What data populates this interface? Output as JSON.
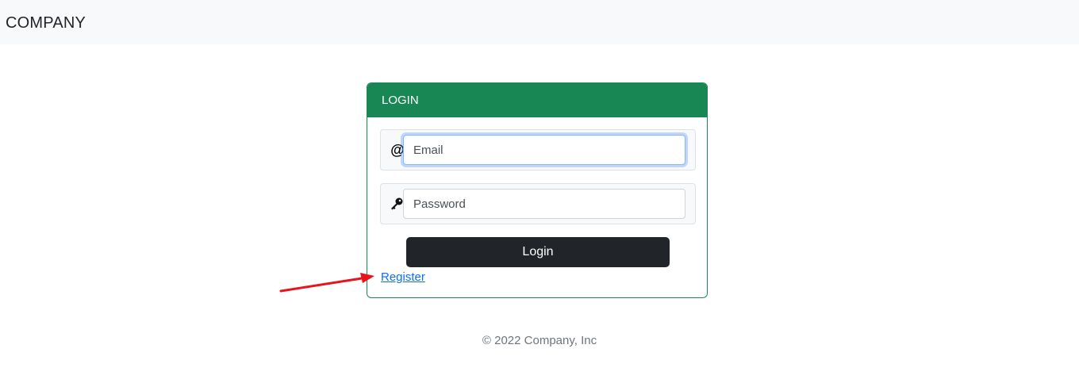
{
  "navbar": {
    "brand": "COMPANY"
  },
  "login_card": {
    "header": "LOGIN",
    "email": {
      "placeholder": "Email",
      "value": "",
      "icon": "at-icon"
    },
    "password": {
      "placeholder": "Password",
      "value": "",
      "icon": "key-icon"
    },
    "login_button": "Login",
    "register_link": "Register"
  },
  "footer": {
    "text": "© 2022 Company, Inc"
  },
  "colors": {
    "header_bg": "#198754",
    "button_bg": "#212529",
    "link": "#0d6efd",
    "annotation_arrow": "#e8141a"
  }
}
